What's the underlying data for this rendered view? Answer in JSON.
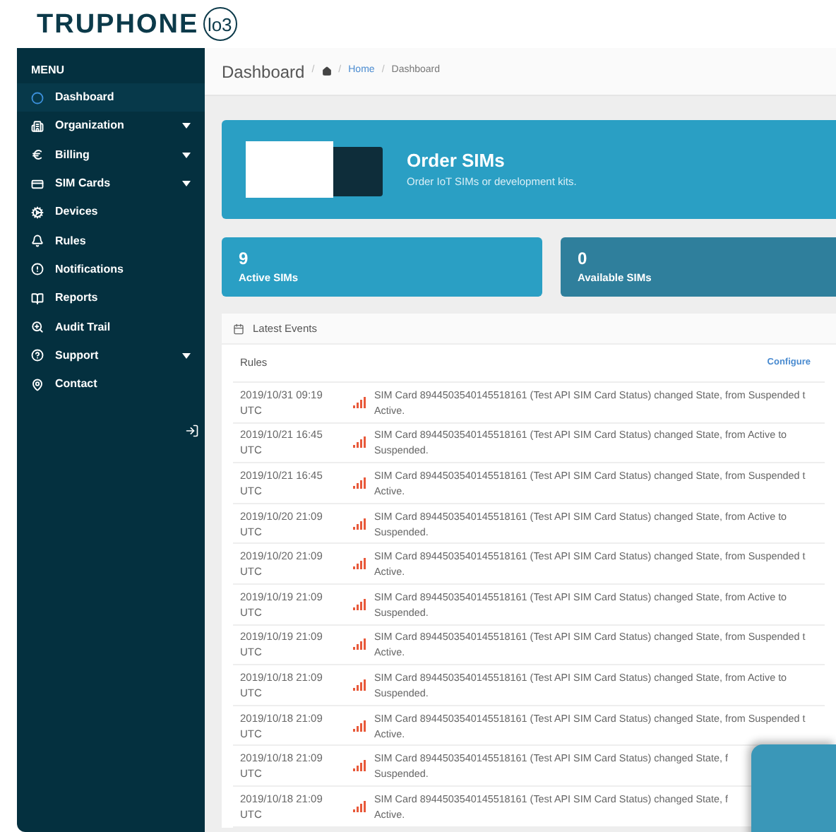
{
  "logo": {
    "brand": "TRUPHONE",
    "badge": "lo3"
  },
  "sidebar": {
    "heading": "MENU",
    "items": [
      {
        "label": "Dashboard",
        "selected": true,
        "has_submenu": false
      },
      {
        "label": "Organization",
        "selected": false,
        "has_submenu": true
      },
      {
        "label": "Billing",
        "selected": false,
        "has_submenu": true
      },
      {
        "label": "SIM Cards",
        "selected": false,
        "has_submenu": true
      },
      {
        "label": "Devices",
        "selected": false,
        "has_submenu": false
      },
      {
        "label": "Rules",
        "selected": false,
        "has_submenu": false
      },
      {
        "label": "Notifications",
        "selected": false,
        "has_submenu": false
      },
      {
        "label": "Reports",
        "selected": false,
        "has_submenu": false
      },
      {
        "label": "Audit Trail",
        "selected": false,
        "has_submenu": false
      },
      {
        "label": "Support",
        "selected": false,
        "has_submenu": true
      },
      {
        "label": "Contact",
        "selected": false,
        "has_submenu": false
      }
    ]
  },
  "page_header": {
    "title": "Dashboard",
    "breadcrumb": [
      {
        "kind": "home",
        "separator": "/"
      },
      {
        "label": "Home",
        "kind": "link",
        "separator": "/"
      },
      {
        "label": "Dashboard",
        "kind": "current",
        "separator": "/"
      }
    ]
  },
  "banner": {
    "title": "Order SIMs",
    "subtitle": "Order IoT SIMs or development kits."
  },
  "stats": [
    {
      "value": "9",
      "label": "Active SIMs",
      "color": "#2a9fc4"
    },
    {
      "value": "0",
      "label": "Available SIMs",
      "color": "#2f7f9c"
    }
  ],
  "events": {
    "title": "Latest Events",
    "column": "Rules",
    "action": "Configure",
    "rows": [
      {
        "time": "2019/10/31 09:19\nUTC",
        "message": "SIM Card 8944503540145518161 (Test API SIM Card Status) changed State, from Suspended t\nActive."
      },
      {
        "time": "2019/10/21 16:45\nUTC",
        "message": "SIM Card 8944503540145518161 (Test API SIM Card Status) changed State, from Active to\nSuspended."
      },
      {
        "time": "2019/10/21 16:45\nUTC",
        "message": "SIM Card 8944503540145518161 (Test API SIM Card Status) changed State, from Suspended t\nActive."
      },
      {
        "time": "2019/10/20 21:09\nUTC",
        "message": "SIM Card 8944503540145518161 (Test API SIM Card Status) changed State, from Active to\nSuspended."
      },
      {
        "time": "2019/10/20 21:09\nUTC",
        "message": "SIM Card 8944503540145518161 (Test API SIM Card Status) changed State, from Suspended t\nActive."
      },
      {
        "time": "2019/10/19 21:09\nUTC",
        "message": "SIM Card 8944503540145518161 (Test API SIM Card Status) changed State, from Active to\nSuspended."
      },
      {
        "time": "2019/10/19 21:09\nUTC",
        "message": "SIM Card 8944503540145518161 (Test API SIM Card Status) changed State, from Suspended t\nActive."
      },
      {
        "time": "2019/10/18 21:09\nUTC",
        "message": "SIM Card 8944503540145518161 (Test API SIM Card Status) changed State, from Active to\nSuspended."
      },
      {
        "time": "2019/10/18 21:09\nUTC",
        "message": "SIM Card 8944503540145518161 (Test API SIM Card Status) changed State, from Suspended t\nActive."
      },
      {
        "time": "2019/10/18 21:09\nUTC",
        "message": "SIM Card 8944503540145518161 (Test API SIM Card Status) changed State, f\nSuspended."
      },
      {
        "time": "2019/10/18 21:09\nUTC",
        "message": "SIM Card 8944503540145518161 (Test API SIM Card Status) changed State, f\nActive."
      }
    ]
  }
}
